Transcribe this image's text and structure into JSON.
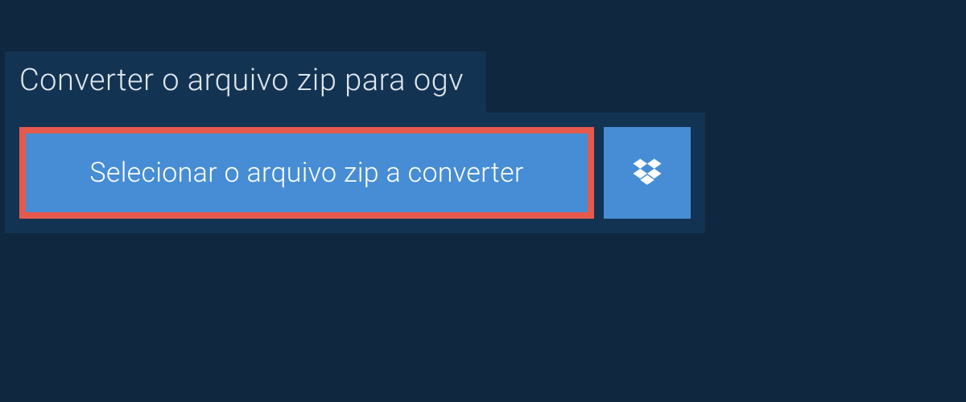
{
  "header": {
    "title": "Converter o arquivo zip para ogv"
  },
  "actions": {
    "select_file_label": "Selecionar o arquivo zip a converter"
  }
}
